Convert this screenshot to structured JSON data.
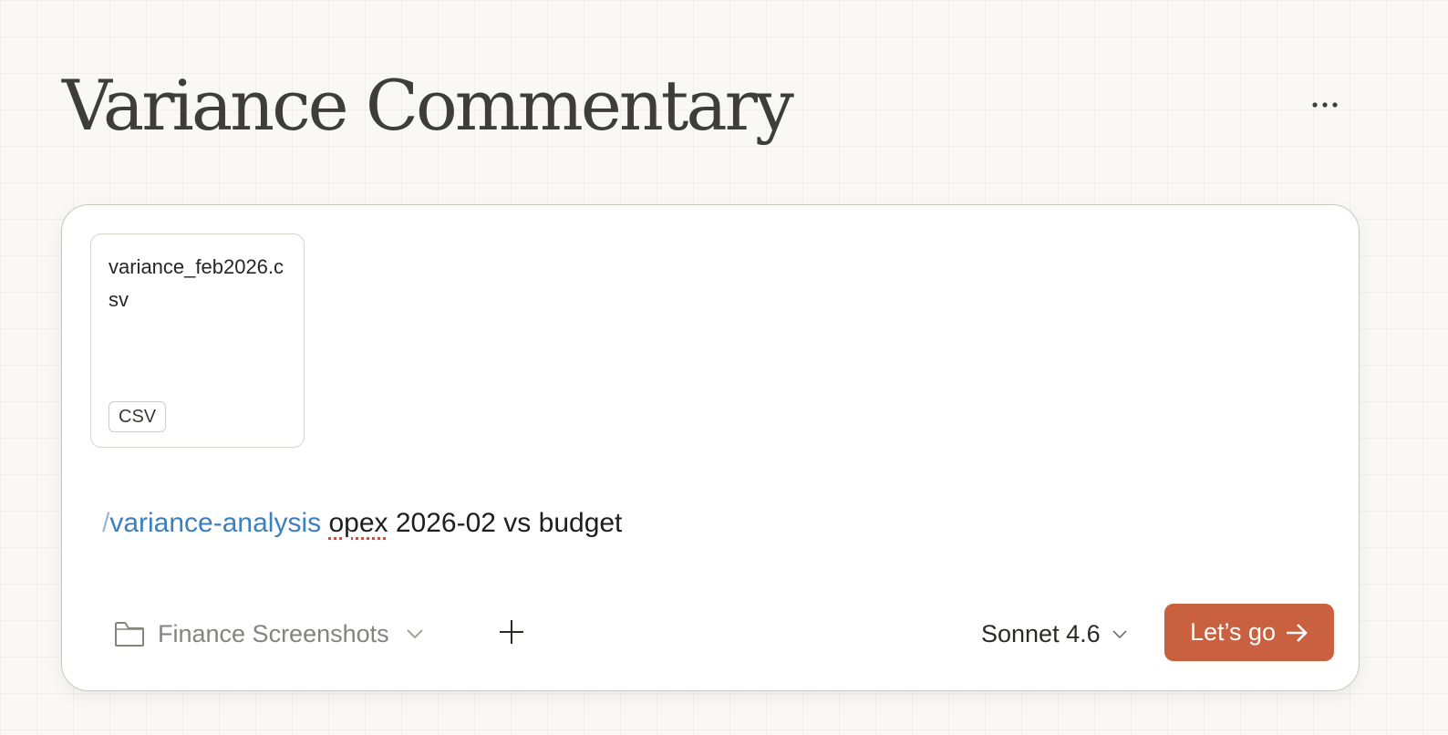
{
  "header": {
    "title": "Variance Commentary",
    "more_icon": "ellipsis-icon"
  },
  "composer": {
    "attachment": {
      "file_name": "variance_feb2026.csv",
      "file_type": "CSV"
    },
    "prompt": {
      "slash": "/",
      "command": "variance-analysis",
      "misspelled_word": "opex",
      "rest": " 2026-02 vs budget"
    },
    "toolbar": {
      "project_icon": "folder-icon",
      "project_label": "Finance Screenshots",
      "add_icon": "plus-icon",
      "model_label": "Sonnet 4.6",
      "submit_label": "Let’s go",
      "submit_icon": "arrow-right-icon"
    }
  },
  "colors": {
    "accent": "#c9603f",
    "command": "#3b7fbf",
    "background": "#f9f8f5"
  }
}
